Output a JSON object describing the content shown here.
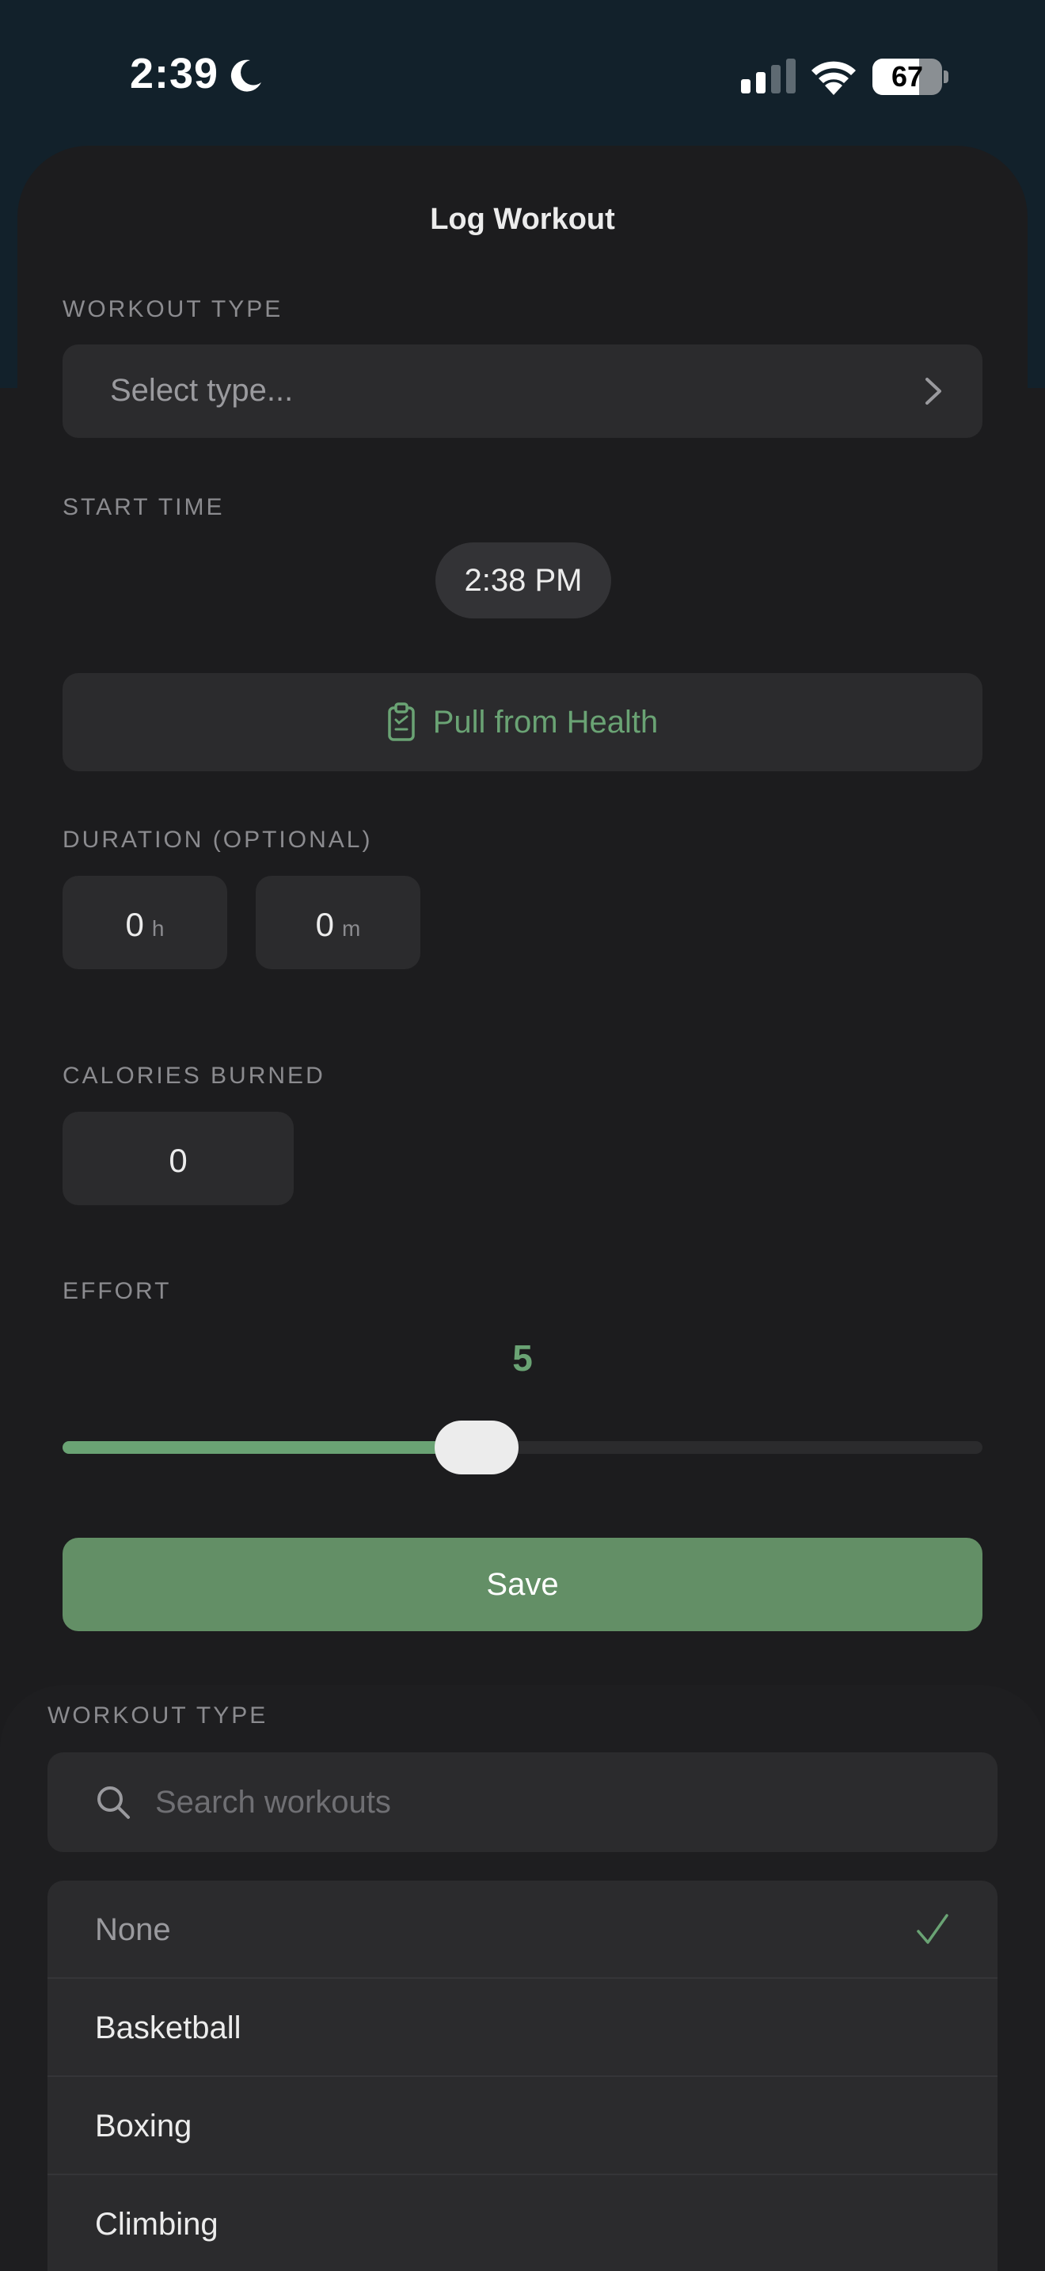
{
  "status_bar": {
    "time": "2:39",
    "battery": "67",
    "battery_level": 0.67,
    "icons": [
      "moon-icon",
      "cellular-signal-icon",
      "wifi-icon",
      "battery-icon"
    ]
  },
  "form": {
    "title": "Log Workout",
    "workout_type": {
      "label": "WORKOUT TYPE",
      "placeholder": "Select type..."
    },
    "start_time": {
      "label": "START TIME",
      "value": "2:38 PM"
    },
    "health_button": {
      "label": "Pull from Health",
      "icon": "clipboard-icon"
    },
    "duration": {
      "label": "DURATION (OPTIONAL)",
      "hours": "0",
      "hours_unit": "h",
      "minutes": "0",
      "minutes_unit": "m"
    },
    "calories": {
      "label": "CALORIES BURNED",
      "value": "0"
    },
    "effort": {
      "label": "EFFORT",
      "value": "5",
      "level": 0.45
    },
    "save_label": "Save"
  },
  "picker": {
    "label": "WORKOUT TYPE",
    "search_placeholder": "Search workouts",
    "options": [
      {
        "label": "None",
        "selected": true
      },
      {
        "label": "Basketball",
        "selected": false
      },
      {
        "label": "Boxing",
        "selected": false
      },
      {
        "label": "Climbing",
        "selected": false
      }
    ]
  },
  "colors": {
    "accent": "#6aa374",
    "save_button": "#638f66",
    "background": "#1c1c1e",
    "field": "#2b2b2d"
  }
}
